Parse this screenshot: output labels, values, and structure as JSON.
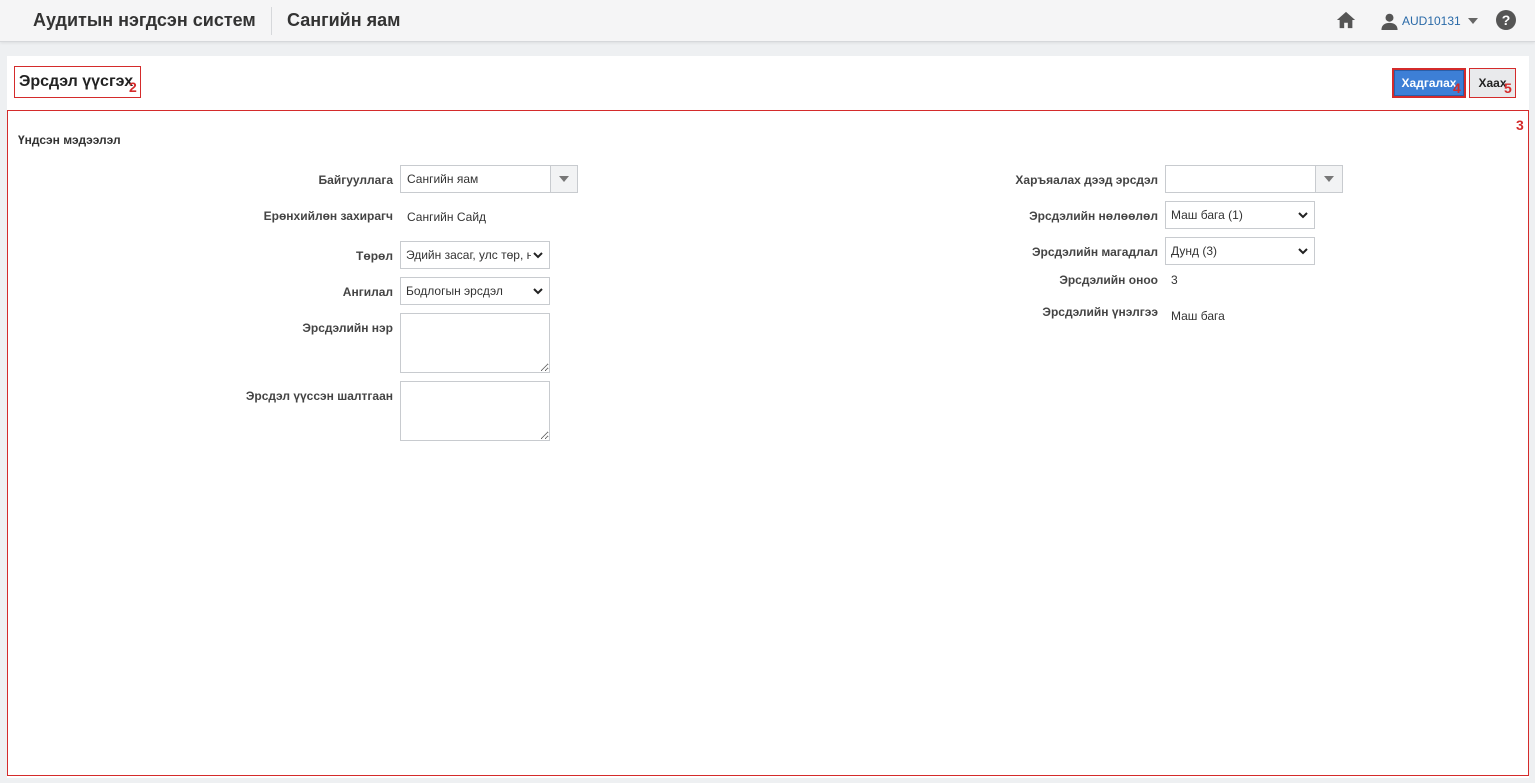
{
  "header": {
    "app_title": "Аудитын нэгдсэн систем",
    "org_title": "Сангийн яам",
    "user_name": "AUD10131"
  },
  "page": {
    "title": "Эрсдэл үүсгэх",
    "save_label": "Хадгалах",
    "close_label": "Хаах",
    "markers": {
      "title": "2",
      "form": "3",
      "save": "4",
      "close": "5"
    }
  },
  "form": {
    "section_title": "Үндсэн мэдээлэл",
    "organization": {
      "label": "Байгууллага",
      "value": "Сангийн яам"
    },
    "general_manager": {
      "label": "Ерөнхийлөн захирагч",
      "value": "Сангийн Сайд"
    },
    "type": {
      "label": "Төрөл",
      "value": "Эдийн засаг, улс төр, нийгмийн"
    },
    "category": {
      "label": "Ангилал",
      "value": "Бодлогын эрсдэл"
    },
    "risk_name": {
      "label": "Эрсдэлийн нэр",
      "value": ""
    },
    "risk_cause": {
      "label": "Эрсдэл үүссэн шалтгаан",
      "value": ""
    },
    "parent_risk": {
      "label": "Харъяалах дээд эрсдэл",
      "value": ""
    },
    "risk_impact": {
      "label": "Эрсдэлийн нөлөөлөл",
      "value": "Маш бага (1)"
    },
    "risk_probability": {
      "label": "Эрсдэлийн магадлал",
      "value": "Дунд (3)"
    },
    "risk_score": {
      "label": "Эрсдэлийн оноо",
      "value": "3"
    },
    "risk_assessment": {
      "label": "Эрсдэлийн үнэлгээ",
      "value": "Маш бага"
    }
  },
  "colors": {
    "accent": "#3d7fd6",
    "annotation": "#d42b2b",
    "user_link": "#2a6aa8"
  }
}
